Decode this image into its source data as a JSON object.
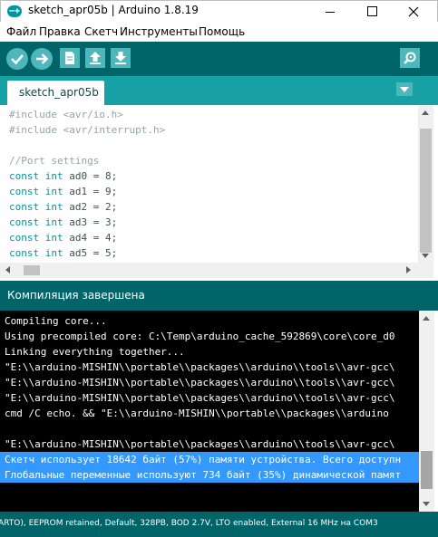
{
  "window": {
    "title": "sketch_apr05b | Arduino 1.8.19",
    "icon": "arduino-logo-icon",
    "controls": [
      "minimize-icon",
      "maximize-icon",
      "close-icon"
    ]
  },
  "menu": [
    "Файл",
    "Правка",
    "Скетч",
    "Инструменты",
    "Помощь"
  ],
  "toolbar": {
    "buttons": [
      "verify-icon",
      "upload-icon",
      "new-icon",
      "open-icon",
      "save-icon",
      "serial-monitor-icon"
    ]
  },
  "tabs": {
    "active": "sketch_apr05b",
    "menu_icon": "tab-menu-icon"
  },
  "editor": {
    "lines": [
      "#include <avr/io.h>",
      "#include <avr/interrupt.h>",
      "",
      "//Port settings",
      "const int ad0 = 8;",
      "const int ad1 = 9;",
      "const int ad2 = 2;",
      "const int ad3 = 3;",
      "const int ad4 = 4;",
      "const int ad5 = 5;"
    ]
  },
  "status": {
    "message": "Компиляция завершена"
  },
  "console": {
    "lines": [
      "Compiling core...",
      "Using precompiled core: C:\\Temp\\arduino_cache_592869\\core\\core_d0",
      "Linking everything together...",
      "\"E:\\\\arduino-MISHIN\\\\portable\\\\packages\\\\arduino\\\\tools\\\\avr-gcc\\",
      "\"E:\\\\arduino-MISHIN\\\\portable\\\\packages\\\\arduino\\\\tools\\\\avr-gcc\\",
      "\"E:\\\\arduino-MISHIN\\\\portable\\\\packages\\\\arduino\\\\tools\\\\avr-gcc\\",
      "cmd /C echo. && \"E:\\\\arduino-MISHIN\\\\portable\\\\packages\\\\arduino",
      "",
      "\"E:\\\\arduino-MISHIN\\\\portable\\\\packages\\\\arduino\\\\tools\\\\avr-gcc\\",
      "Скетч использует 18642 байт (57%) памяти устройства. Всего доступн",
      "Глобальные переменные используют 734 байт (35%) динамической памят"
    ],
    "selected_lines": [
      9,
      10
    ]
  },
  "board": {
    "text": "ARTO), EEPROM retained, Default, 328PB, BOD 2.7V, LTO enabled, External 16 MHz на COM3"
  },
  "colors": {
    "toolbar_bg": "#006468",
    "tab_strip_bg": "#17a1a5",
    "button_bg": "#4db7bb",
    "keyword": "#00979c",
    "console_bg": "#000000",
    "selection": "#3399ff"
  }
}
